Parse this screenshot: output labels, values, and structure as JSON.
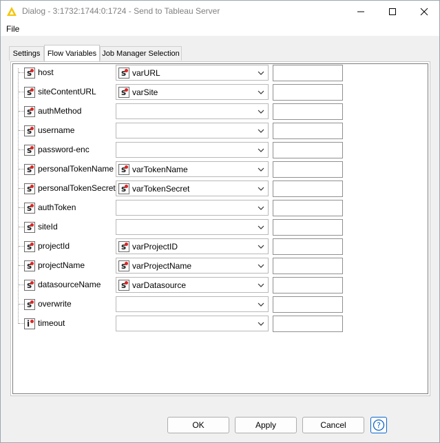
{
  "window": {
    "title": "Dialog - 3:1732:1744:0:1724 - Send to Tableau Server",
    "icon": "knime-triangle-icon",
    "accent": "#f5c400"
  },
  "menu": {
    "file_label": "File"
  },
  "tabs": [
    {
      "label": "Settings",
      "active": false
    },
    {
      "label": "Flow Variables",
      "active": true
    },
    {
      "label": "Job Manager Selection",
      "active": false
    }
  ],
  "variables": [
    {
      "name": "host",
      "type": "s",
      "value": "varURL"
    },
    {
      "name": "siteContentURL",
      "type": "s",
      "value": "varSite"
    },
    {
      "name": "authMethod",
      "type": "s",
      "value": ""
    },
    {
      "name": "username",
      "type": "s",
      "value": ""
    },
    {
      "name": "password-enc",
      "type": "s",
      "value": ""
    },
    {
      "name": "personalTokenName",
      "type": "s",
      "value": "varTokenName"
    },
    {
      "name": "personalTokenSecret",
      "type": "s",
      "value": "varTokenSecret"
    },
    {
      "name": "authToken",
      "type": "s",
      "value": ""
    },
    {
      "name": "siteId",
      "type": "s",
      "value": ""
    },
    {
      "name": "projectId",
      "type": "s",
      "value": "varProjectID"
    },
    {
      "name": "projectName",
      "type": "s",
      "value": "varProjectName"
    },
    {
      "name": "datasourceName",
      "type": "s",
      "value": "varDatasource"
    },
    {
      "name": "overwrite",
      "type": "s",
      "value": ""
    },
    {
      "name": "timeout",
      "type": "i",
      "value": ""
    }
  ],
  "buttons": {
    "ok": "OK",
    "apply": "Apply",
    "cancel": "Cancel",
    "help": "?"
  }
}
